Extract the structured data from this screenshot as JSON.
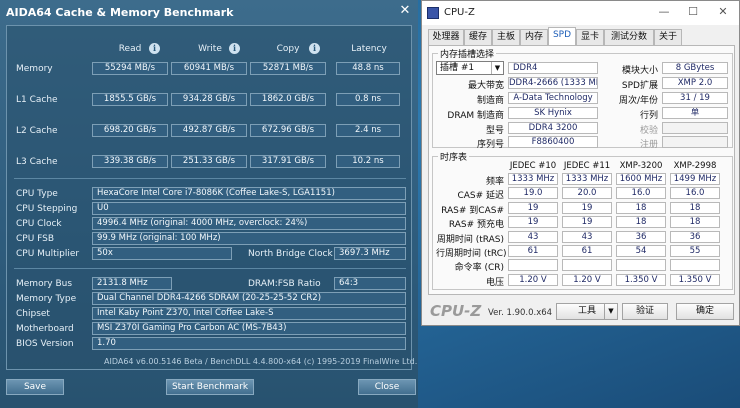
{
  "aida": {
    "title": "AIDA64 Cache & Memory Benchmark",
    "close_glyph": "✕",
    "info_glyph": "i",
    "headers": {
      "read": "Read",
      "write": "Write",
      "copy": "Copy",
      "latency": "Latency"
    },
    "bench_rows": [
      {
        "label": "Memory",
        "read": "55294 MB/s",
        "write": "60941 MB/s",
        "copy": "52871 MB/s",
        "latency": "48.8 ns"
      },
      {
        "label": "L1 Cache",
        "read": "1855.5 GB/s",
        "write": "934.28 GB/s",
        "copy": "1862.0 GB/s",
        "latency": "0.8 ns"
      },
      {
        "label": "L2 Cache",
        "read": "698.20 GB/s",
        "write": "492.87 GB/s",
        "copy": "672.96 GB/s",
        "latency": "2.4 ns"
      },
      {
        "label": "L3 Cache",
        "read": "339.38 GB/s",
        "write": "251.33 GB/s",
        "copy": "317.91 GB/s",
        "latency": "10.2 ns"
      }
    ],
    "cpu": {
      "type_label": "CPU Type",
      "type": "HexaCore Intel Core i7-8086K  (Coffee Lake-S, LGA1151)",
      "stepping_label": "CPU Stepping",
      "stepping": "U0",
      "clock_label": "CPU Clock",
      "clock": "4996.4 MHz  (original: 4000 MHz, overclock: 24%)",
      "fsb_label": "CPU FSB",
      "fsb": "99.9 MHz  (original: 100 MHz)",
      "multiplier_label": "CPU Multiplier",
      "multiplier": "50x",
      "nb_clock_label": "North Bridge Clock",
      "nb_clock": "3697.3 MHz"
    },
    "memory": {
      "bus_label": "Memory Bus",
      "bus": "2131.8 MHz",
      "ratio_label": "DRAM:FSB Ratio",
      "ratio": "64:3",
      "type_label": "Memory Type",
      "type": "Dual Channel DDR4-4266 SDRAM  (20-25-25-52 CR2)",
      "chipset_label": "Chipset",
      "chipset": "Intel Kaby Point Z370, Intel Coffee Lake-S",
      "motherboard_label": "Motherboard",
      "motherboard": "MSI Z370I Gaming Pro Carbon AC (MS-7B43)",
      "bios_label": "BIOS Version",
      "bios": "1.70"
    },
    "footer": "AIDA64 v6.00.5146 Beta / BenchDLL 4.4.800-x64  (c) 1995-2019 FinalWire Ltd.",
    "buttons": {
      "save": "Save",
      "start": "Start Benchmark",
      "close": "Close"
    }
  },
  "cpuz": {
    "title": "CPU-Z",
    "controls": {
      "minimize": "—",
      "maximize": "☐",
      "close": "✕"
    },
    "tabs": [
      "处理器",
      "缓存",
      "主板",
      "内存",
      "SPD",
      "显卡",
      "测试分数",
      "关于"
    ],
    "active_tab": "SPD",
    "slot_group_title": "内存插槽选择",
    "slot_select": "插槽 #1",
    "dropdown_glyph": "▼",
    "module_type": "DDR4",
    "module_size_label": "模块大小",
    "module_size": "8 GBytes",
    "max_bw_label": "最大带宽",
    "max_bw": "DDR4-2666 (1333 MHz)",
    "spd_ext_label": "SPD扩展",
    "spd_ext": "XMP 2.0",
    "manufacturer_label": "制造商",
    "manufacturer": "A-Data Technology",
    "week_year_label": "周次/年份",
    "week_year": "31 / 19",
    "dram_mfr_label": "DRAM 制造商",
    "dram_mfr": "SK Hynix",
    "rank_label": "行列",
    "rank": "单",
    "part_label": "型号",
    "part": "DDR4 3200",
    "correction_label": "校验",
    "registered_label": "注册",
    "serial_label": "序列号",
    "serial": "F8860400",
    "timings_group_title": "时序表",
    "timing_headers": [
      "JEDEC #10",
      "JEDEC #11",
      "XMP-3200",
      "XMP-2998"
    ],
    "timing_rows": [
      {
        "label": "频率",
        "v": [
          "1333 MHz",
          "1333 MHz",
          "1600 MHz",
          "1499 MHz"
        ]
      },
      {
        "label": "CAS# 延迟",
        "v": [
          "19.0",
          "20.0",
          "16.0",
          "16.0"
        ]
      },
      {
        "label": "RAS# 到CAS#",
        "v": [
          "19",
          "19",
          "18",
          "18"
        ]
      },
      {
        "label": "RAS# 预充电",
        "v": [
          "19",
          "19",
          "18",
          "18"
        ]
      },
      {
        "label": "周期时间 (tRAS)",
        "v": [
          "43",
          "43",
          "36",
          "36"
        ]
      },
      {
        "label": "行周期时间 (tRC)",
        "v": [
          "61",
          "61",
          "54",
          "55"
        ]
      },
      {
        "label": "命令率 (CR)",
        "v": [
          "",
          "",
          "",
          ""
        ]
      },
      {
        "label": "电压",
        "v": [
          "1.20 V",
          "1.20 V",
          "1.350 V",
          "1.350 V"
        ]
      }
    ],
    "brand": "CPU-Z",
    "version": "Ver. 1.90.0.x64",
    "tools_button": "工具",
    "validate_button": "验证",
    "ok_button": "确定"
  }
}
